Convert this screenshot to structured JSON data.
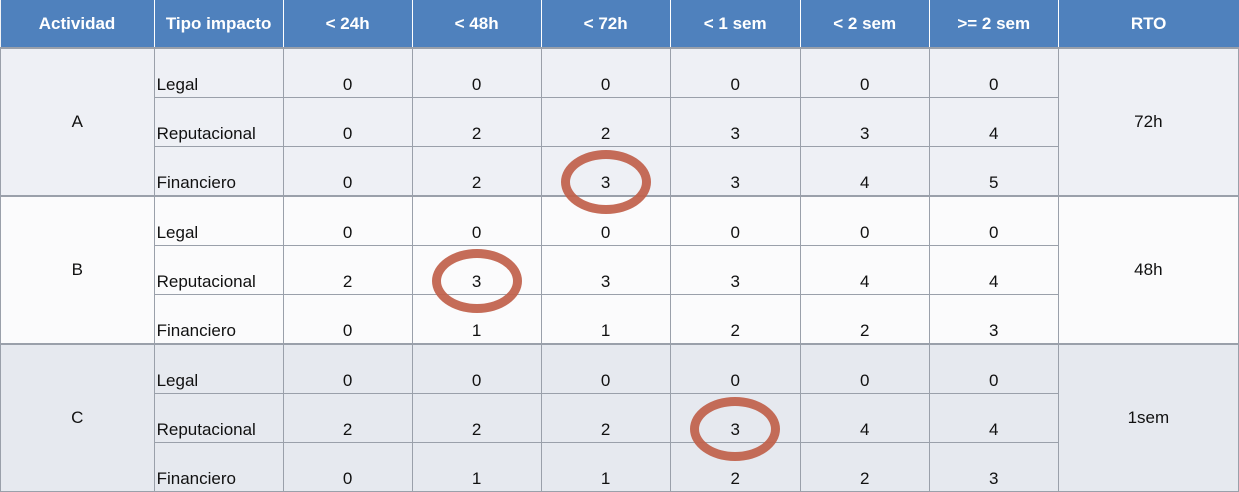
{
  "headers": [
    "Actividad",
    "Tipo impacto",
    "< 24h",
    "< 48h",
    "< 72h",
    "< 1 sem",
    "< 2 sem",
    ">= 2 sem",
    "RTO"
  ],
  "groups": [
    {
      "actividad": "A",
      "rto": "72h",
      "rows": [
        {
          "tipo": "Legal",
          "values": [
            "0",
            "0",
            "0",
            "0",
            "0",
            "0"
          ]
        },
        {
          "tipo": "Reputacional",
          "values": [
            "0",
            "2",
            "2",
            "3",
            "3",
            "4"
          ]
        },
        {
          "tipo": "Financiero",
          "values": [
            "0",
            "2",
            "3",
            "3",
            "4",
            "5"
          ]
        }
      ]
    },
    {
      "actividad": "B",
      "rto": "48h",
      "rows": [
        {
          "tipo": "Legal",
          "values": [
            "0",
            "0",
            "0",
            "0",
            "0",
            "0"
          ]
        },
        {
          "tipo": "Reputacional",
          "values": [
            "2",
            "3",
            "3",
            "3",
            "4",
            "4"
          ]
        },
        {
          "tipo": "Financiero",
          "values": [
            "0",
            "1",
            "1",
            "2",
            "2",
            "3"
          ]
        }
      ]
    },
    {
      "actividad": "C",
      "rto": "1sem",
      "rows": [
        {
          "tipo": "Legal",
          "values": [
            "0",
            "0",
            "0",
            "0",
            "0",
            "0"
          ]
        },
        {
          "tipo": "Reputacional",
          "values": [
            "2",
            "2",
            "2",
            "3",
            "4",
            "4"
          ]
        },
        {
          "tipo": "Financiero",
          "values": [
            "0",
            "1",
            "1",
            "2",
            "2",
            "3"
          ]
        }
      ]
    }
  ],
  "highlights": [
    {
      "actividad": "A",
      "tipo": "Financiero",
      "column": "< 72h"
    },
    {
      "actividad": "B",
      "tipo": "Reputacional",
      "column": "< 48h"
    },
    {
      "actividad": "C",
      "tipo": "Reputacional",
      "column": "< 1 sem"
    }
  ],
  "colors": {
    "header_bg": "#4f81bd",
    "header_text": "#ffffff",
    "group_a_bg": "#eef0f5",
    "group_b_bg": "#fbfbfc",
    "group_c_bg": "#e6e9ef",
    "highlight_ring": "#c0604a"
  }
}
